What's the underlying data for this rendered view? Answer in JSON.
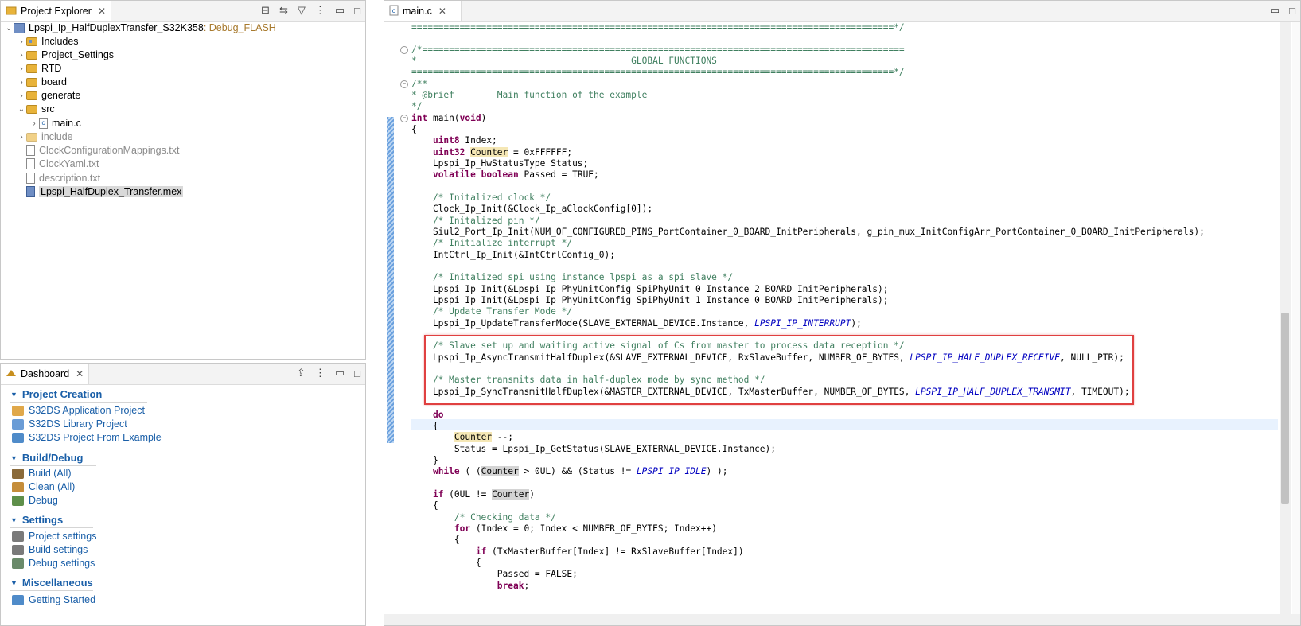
{
  "project_explorer": {
    "tab_label": "Project Explorer",
    "root": {
      "name": "Lpspi_Ip_HalfDuplexTransfer_S32K358",
      "config": ": Debug_FLASH"
    },
    "items": [
      {
        "label": "Includes"
      },
      {
        "label": "Project_Settings"
      },
      {
        "label": "RTD"
      },
      {
        "label": "board"
      },
      {
        "label": "generate"
      },
      {
        "label": "src"
      },
      {
        "label": "main.c"
      },
      {
        "label": "include"
      },
      {
        "label": "ClockConfigurationMappings.txt"
      },
      {
        "label": "ClockYaml.txt"
      },
      {
        "label": "description.txt"
      },
      {
        "label": "Lpspi_HalfDuplex_Transfer.mex"
      }
    ]
  },
  "dashboard": {
    "tab_label": "Dashboard",
    "sections": [
      {
        "title": "Project Creation",
        "items": [
          "S32DS Application Project",
          "S32DS Library Project",
          "S32DS Project From Example"
        ]
      },
      {
        "title": "Build/Debug",
        "items": [
          "Build   (All)",
          "Clean   (All)",
          "Debug"
        ]
      },
      {
        "title": "Settings",
        "items": [
          "Project settings",
          "Build settings",
          "Debug settings"
        ]
      },
      {
        "title": "Miscellaneous",
        "items": [
          "Getting Started"
        ]
      }
    ]
  },
  "editor": {
    "tab_label": "main.c",
    "colors": {
      "comment": "#3f7f5f",
      "keyword": "#7f0055",
      "enum": "#0000c0",
      "highlight_box": "#e04040"
    },
    "lines": [
      "==========================================================================================*/",
      "",
      "/*==========================================================================================",
      "*                                        GLOBAL FUNCTIONS",
      "==========================================================================================*/",
      "/**",
      "* @brief        Main function of the example",
      "*/",
      "int main(void)",
      "{",
      "    uint8 Index;",
      "    uint32 Counter = 0xFFFFFF;",
      "    Lpspi_Ip_HwStatusType Status;",
      "    volatile boolean Passed = TRUE;",
      "",
      "    /* Initalized clock */",
      "    Clock_Ip_Init(&Clock_Ip_aClockConfig[0]);",
      "    /* Initalized pin */",
      "    Siul2_Port_Ip_Init(NUM_OF_CONFIGURED_PINS_PortContainer_0_BOARD_InitPeripherals, g_pin_mux_InitConfigArr_PortContainer_0_BOARD_InitPeripherals);",
      "    /* Initialize interrupt */",
      "    IntCtrl_Ip_Init(&IntCtrlConfig_0);",
      "",
      "    /* Initalized spi using instance lpspi as a spi slave */",
      "    Lpspi_Ip_Init(&Lpspi_Ip_PhyUnitConfig_SpiPhyUnit_0_Instance_2_BOARD_InitPeripherals);",
      "    Lpspi_Ip_Init(&Lpspi_Ip_PhyUnitConfig_SpiPhyUnit_1_Instance_0_BOARD_InitPeripherals);",
      "    /* Update Transfer Mode */",
      "    Lpspi_Ip_UpdateTransferMode(SLAVE_EXTERNAL_DEVICE.Instance, LPSPI_IP_INTERRUPT);",
      "",
      "    /* Slave set up and waiting active signal of Cs from master to process data reception */",
      "    Lpspi_Ip_AsyncTransmitHalfDuplex(&SLAVE_EXTERNAL_DEVICE, RxSlaveBuffer, NUMBER_OF_BYTES, LPSPI_IP_HALF_DUPLEX_RECEIVE, NULL_PTR);",
      "",
      "    /* Master transmits data in half-duplex mode by sync method */",
      "    Lpspi_Ip_SyncTransmitHalfDuplex(&MASTER_EXTERNAL_DEVICE, TxMasterBuffer, NUMBER_OF_BYTES, LPSPI_IP_HALF_DUPLEX_TRANSMIT, TIMEOUT);",
      "",
      "    do",
      "    {",
      "        Counter --;",
      "        Status = Lpspi_Ip_GetStatus(SLAVE_EXTERNAL_DEVICE.Instance);",
      "    }",
      "    while ( (Counter > 0UL) && (Status != LPSPI_IP_IDLE) );",
      "",
      "    if (0UL != Counter)",
      "    {",
      "        /* Checking data */",
      "        for (Index = 0; Index < NUMBER_OF_BYTES; Index++)",
      "        {",
      "            if (TxMasterBuffer[Index] != RxSlaveBuffer[Index])",
      "            {",
      "                Passed = FALSE;",
      "                break;"
    ]
  }
}
